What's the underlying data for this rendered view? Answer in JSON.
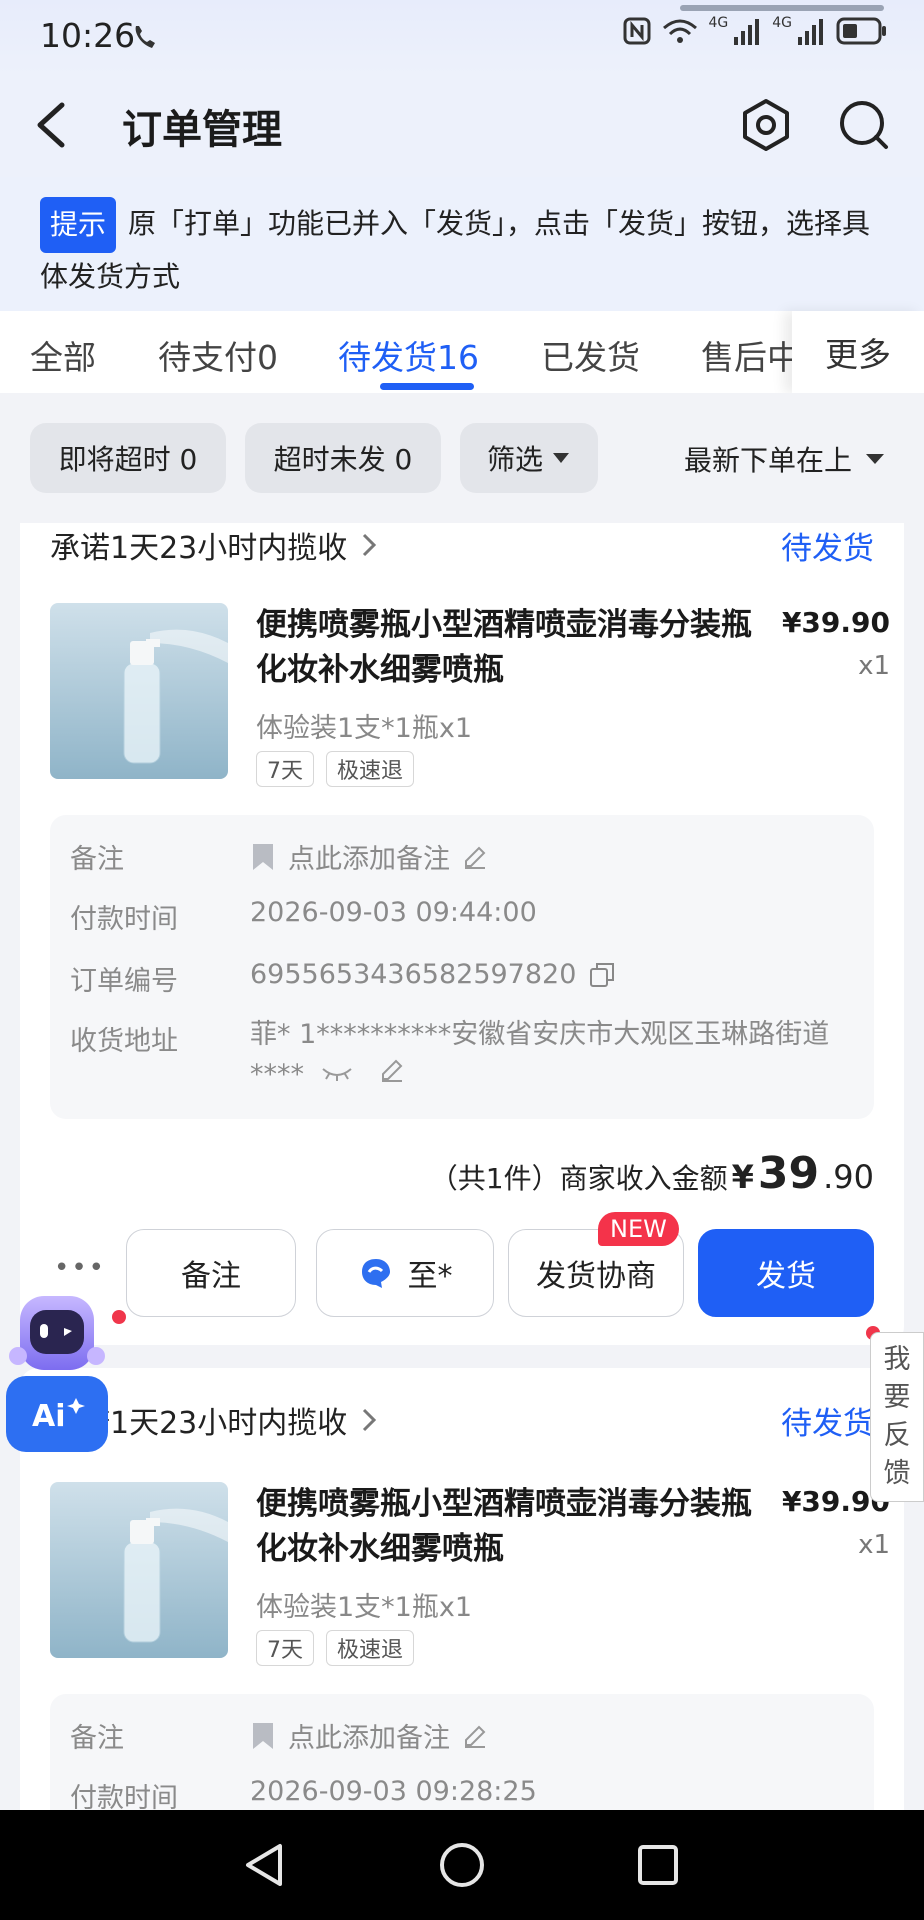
{
  "status_bar": {
    "time": "10:26",
    "network_1": "4G",
    "network_2": "4G"
  },
  "header": {
    "title": "订单管理"
  },
  "notice": {
    "badge": "提示",
    "text": "原「打单」功能已并入「发货」，点击「发货」按钮，选择具体发货方式"
  },
  "tabs": [
    {
      "label": "全部"
    },
    {
      "label": "待支付0"
    },
    {
      "label": "待发货16"
    },
    {
      "label": "已发货"
    },
    {
      "label": "售后中"
    }
  ],
  "tab_more": "更多",
  "filters": {
    "chip_1": "即将超时 0",
    "chip_2": "超时未发 0",
    "chip_3": "筛选",
    "sort": "最新下单在上"
  },
  "orders": [
    {
      "promise": "承诺1天23小时内揽收",
      "status": "待发货",
      "title": "便携喷雾瓶小型酒精喷壶消毒分装瓶化妆补水细雾喷瓶",
      "price": "¥39.90",
      "qty": "x1",
      "spec": "体验装1支*1瓶x1",
      "tags": [
        "7天",
        "极速退"
      ],
      "remark_label": "备注",
      "remark_value": "点此添加备注",
      "pay_time_label": "付款时间",
      "pay_time": "2026-09-03 09:44:00",
      "order_no_label": "订单编号",
      "order_no": "6955653436582597820",
      "address_label": "收货地址",
      "address": "菲* 1**********安徽省安庆市大观区玉琳路街道****",
      "income_label": "（共1件）商家收入金额",
      "income_currency": "¥",
      "income_int": "39",
      "income_dec": ".90",
      "btn_more": "•••",
      "btn_remark": "备注",
      "btn_contact": "至*",
      "btn_negotiate": "发货协商",
      "new_badge": "NEW",
      "btn_ship": "发货"
    },
    {
      "promise": "承诺1天23小时内揽收",
      "status": "待发货",
      "title": "便携喷雾瓶小型酒精喷壶消毒分装瓶化妆补水细雾喷瓶",
      "price": "¥39.90",
      "qty": "x1",
      "spec": "体验装1支*1瓶x1",
      "tags": [
        "7天",
        "极速退"
      ],
      "remark_label": "备注",
      "remark_value": "点此添加备注",
      "pay_time_label": "付款时间",
      "pay_time": "2026-09-03 09:28:25"
    }
  ],
  "feedback": "我要反馈",
  "colors": {
    "accent": "#1f5ff5",
    "badge_red": "#f4334a"
  }
}
